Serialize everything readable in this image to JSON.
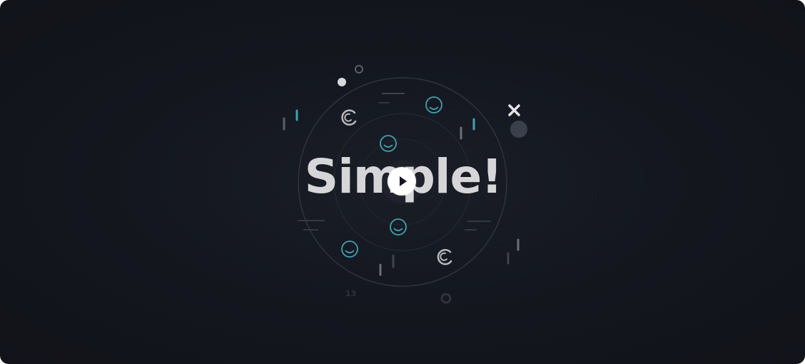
{
  "video": {
    "headline": "Simple!",
    "play_icon": "play-icon",
    "close_glyph": "×",
    "small_label": "13"
  },
  "colors": {
    "background": "#14171f",
    "headline": "#d6d6d8",
    "accent_teal": "#3fa3b0",
    "line_grey": "#5a5e66",
    "play_button": "#ffffff",
    "play_glyph": "#14171f"
  }
}
